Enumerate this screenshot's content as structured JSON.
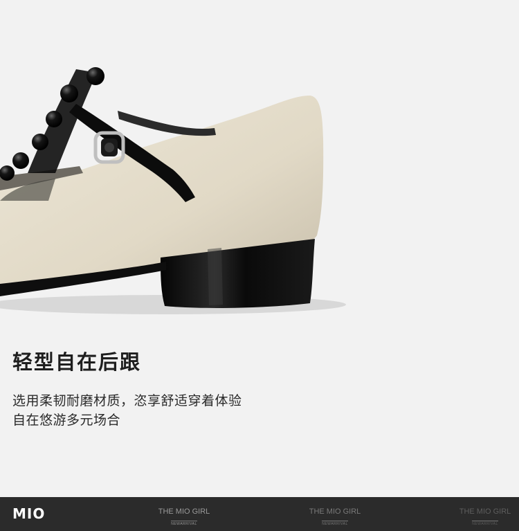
{
  "feature": {
    "title": "轻型自在后跟",
    "description_lines": [
      "选用柔韧耐磨材质，恣享舒适穿着体验",
      "自在悠游多元场合"
    ]
  },
  "footer": {
    "brand": "MIO",
    "watermarks": [
      {
        "main": "THE MIO GIRL",
        "sub": "NEWARRIVAL"
      },
      {
        "main": "THE MIO GIRL",
        "sub": "NEWARRIVAL"
      },
      {
        "main": "THE MIO GIRL",
        "sub": "NEWARRIVAL"
      }
    ]
  },
  "colors": {
    "background": "#f2f2f2",
    "leather": "#e4ddcb",
    "patent_black": "#111111",
    "footer": "#2b2b2b"
  }
}
